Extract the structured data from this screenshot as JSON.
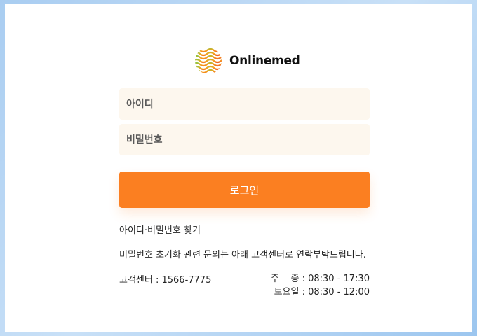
{
  "brand": {
    "name": "Onlinemed",
    "logo_icon": "wave-globe-logo",
    "logo_colors": [
      "#f47b20",
      "#8dc63f",
      "#ef5a24"
    ]
  },
  "form": {
    "id_placeholder": "아이디",
    "pw_placeholder": "비밀번호",
    "login_label": "로그인"
  },
  "links": {
    "find_account": "아이디·비밀번호 찾기"
  },
  "notice": "비밀번호 초기화 관련 문의는 아래 고객센터로 연락부탁드립니다.",
  "contact": {
    "center": "고객센터 : 1566-7775",
    "weekday": "주    중 : 08:30 - 17:30",
    "saturday": "토요일 : 08:30 - 12:00"
  },
  "colors": {
    "accent": "#fb7f21",
    "field_bg": "#fdf7ee",
    "page_bg": "#b8d7f4"
  }
}
